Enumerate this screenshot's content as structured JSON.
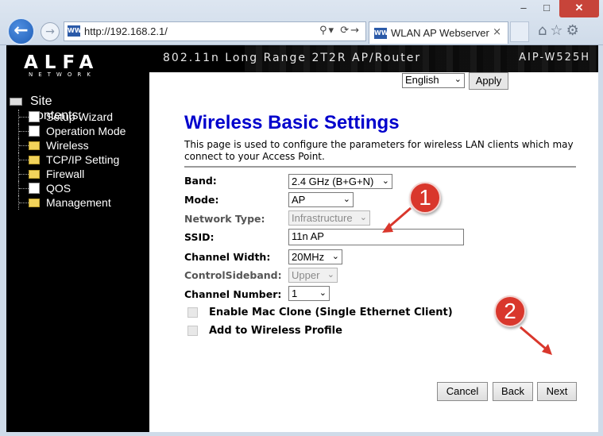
{
  "browser": {
    "url": "http://192.168.2.1/",
    "tab_title": "WLAN AP Webserver",
    "tab_close": "×",
    "back_glyph": "←",
    "forward_glyph": "→",
    "address_tools": "⚲▾ ⟳→",
    "toolbar_icons": "⌂☆⚙",
    "site_icon_text": "WW",
    "window_controls": {
      "minimize": "–",
      "maximize": "□",
      "close": "✕"
    }
  },
  "banner": {
    "logo": "ALFA",
    "logo_sub": "NETWORK",
    "title": "802.11n Long Range 2T2R AP/Router",
    "model": "AIP-W525H"
  },
  "sidebar": {
    "heading": "Site contents:",
    "items": [
      {
        "label": "Setup Wizard",
        "icon": "document-icon"
      },
      {
        "label": "Operation Mode",
        "icon": "document-icon"
      },
      {
        "label": "Wireless",
        "icon": "folder-icon"
      },
      {
        "label": "TCP/IP Setting",
        "icon": "folder-icon"
      },
      {
        "label": "Firewall",
        "icon": "folder-icon"
      },
      {
        "label": "QOS",
        "icon": "document-icon"
      },
      {
        "label": "Management",
        "icon": "folder-icon"
      }
    ]
  },
  "language": {
    "selected": "English",
    "apply_label": "Apply"
  },
  "main": {
    "title": "Wireless Basic Settings",
    "description": "This page is used to configure the parameters for wireless LAN clients which may connect to your Access Point.",
    "fields": {
      "band": {
        "label": "Band:",
        "value": "2.4 GHz (B+G+N)"
      },
      "mode": {
        "label": "Mode:",
        "value": "AP"
      },
      "network_type": {
        "label": "Network Type:",
        "value": "Infrastructure"
      },
      "ssid": {
        "label": "SSID:",
        "value": "11n AP"
      },
      "channel_width": {
        "label": "Channel Width:",
        "value": "20MHz"
      },
      "control_sideband": {
        "label": "ControlSideband:",
        "value": "Upper"
      },
      "channel_number": {
        "label": "Channel Number:",
        "value": "1"
      }
    },
    "checkboxes": {
      "mac_clone": {
        "label": "Enable Mac Clone (Single Ethernet Client)",
        "checked": false
      },
      "wireless_profile": {
        "label": "Add to Wireless Profile",
        "checked": false
      }
    },
    "buttons": {
      "cancel": "Cancel",
      "back": "Back",
      "next": "Next"
    }
  },
  "callouts": {
    "one": "1",
    "two": "2"
  },
  "colors": {
    "title_blue": "#0000cc",
    "callout_red": "#d9372c",
    "sidebar_black": "#000000"
  }
}
